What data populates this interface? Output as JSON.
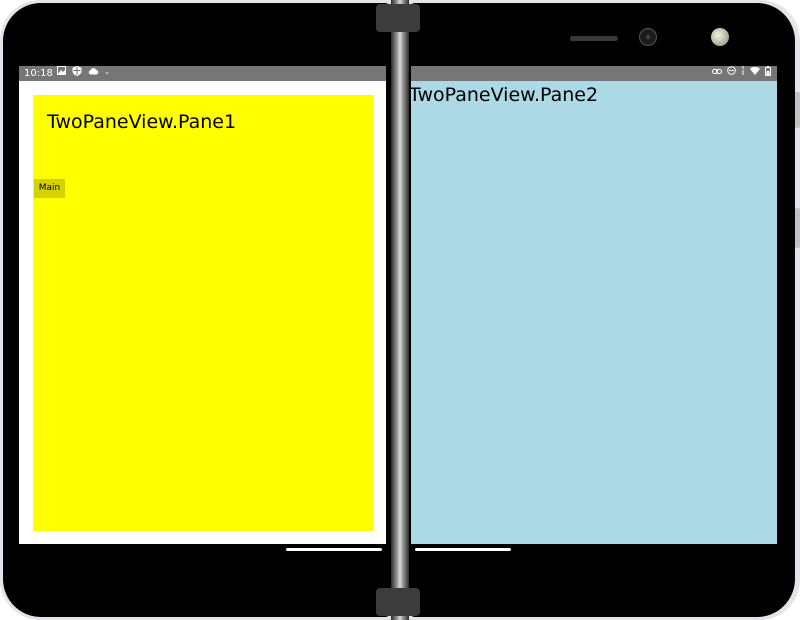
{
  "status_bar": {
    "time": "10:18",
    "left_icons": [
      "image-icon",
      "shield-icon",
      "cloud-icon",
      "dot-icon"
    ],
    "right_icons": [
      "link-icon",
      "do-not-disturb-icon",
      "signal-icon",
      "wifi-icon",
      "battery-icon"
    ]
  },
  "pane1": {
    "title": "TwoPaneView.Pane1",
    "background": "#ffff00",
    "main_button_label": "Main"
  },
  "pane2": {
    "title": "TwoPaneView.Pane2",
    "background": "#add8e6"
  },
  "colors": {
    "status_bar": "#767676",
    "device_bezel": "#000000",
    "device_frame": "#e2e6ea"
  }
}
